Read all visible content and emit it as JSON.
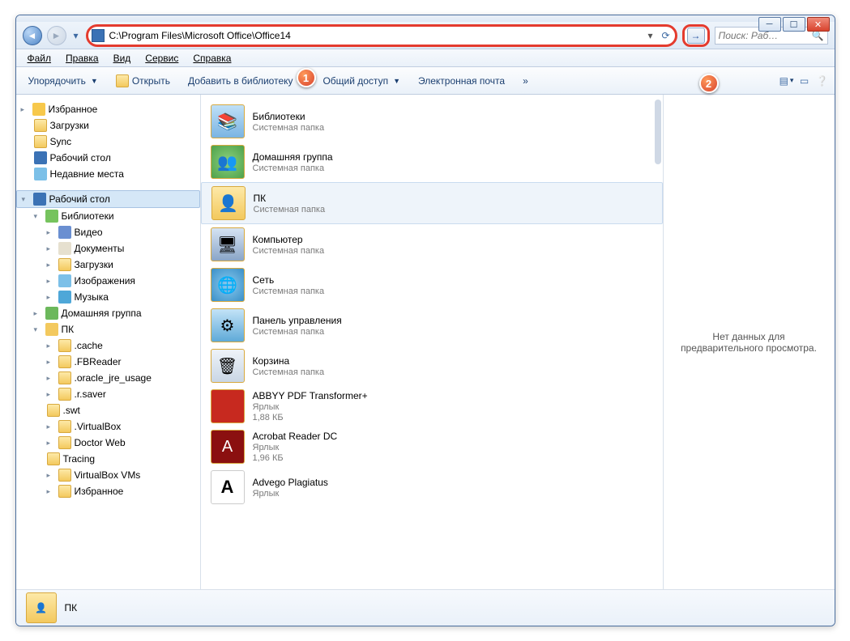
{
  "window": {
    "address": "C:\\Program Files\\Microsoft Office\\Office14",
    "search_placeholder": "Поиск: Раб…"
  },
  "badges": {
    "one": "1",
    "two": "2"
  },
  "menu": [
    "Файл",
    "Правка",
    "Вид",
    "Сервис",
    "Справка"
  ],
  "toolbar": {
    "organize": "Упорядочить",
    "open": "Открыть",
    "addlib": "Добавить в библиотеку",
    "share": "Общий доступ",
    "email": "Электронная почта",
    "more": "»"
  },
  "sidebar": {
    "fav": "Избранное",
    "downloads": "Загрузки",
    "sync": "Sync",
    "desktop": "Рабочий стол",
    "recent": "Недавние места",
    "desktop2": "Рабочий стол",
    "libraries": "Библиотеки",
    "video": "Видео",
    "documents": "Документы",
    "downloads2": "Загрузки",
    "images": "Изображения",
    "music": "Музыка",
    "homegroup": "Домашняя группа",
    "pc": "ПК",
    "cache": ".cache",
    "fbreader": ".FBReader",
    "oracle": ".oracle_jre_usage",
    "rsaver": ".r.saver",
    "swt": ".swt",
    "vbox": ".VirtualBox",
    "drweb": "Doctor Web",
    "tracing": "Tracing",
    "vboxvms": "VirtualBox VMs",
    "fav2": "Избранное"
  },
  "content": [
    {
      "name": "Библиотеки",
      "sub": "Системная папка",
      "icon": "sys"
    },
    {
      "name": "Домашняя группа",
      "sub": "Системная папка",
      "icon": "group"
    },
    {
      "name": "ПК",
      "sub": "Системная папка",
      "icon": "folder",
      "sel": true
    },
    {
      "name": "Компьютер",
      "sub": "Системная папка",
      "icon": "comp"
    },
    {
      "name": "Сеть",
      "sub": "Системная папка",
      "icon": "net"
    },
    {
      "name": "Панель управления",
      "sub": "Системная папка",
      "icon": "ctrl"
    },
    {
      "name": "Корзина",
      "sub": "Системная папка",
      "icon": "trash"
    },
    {
      "name": "ABBYY PDF Transformer+",
      "sub": "Ярлык",
      "sub2": "1,88 КБ",
      "icon": "red"
    },
    {
      "name": "Acrobat Reader DC",
      "sub": "Ярлык",
      "sub2": "1,96 КБ",
      "icon": "dred"
    },
    {
      "name": "Advego Plagiatus",
      "sub": "Ярлык",
      "icon": "white"
    }
  ],
  "preview": "Нет данных для предварительного просмотра.",
  "status": {
    "name": "ПК"
  }
}
